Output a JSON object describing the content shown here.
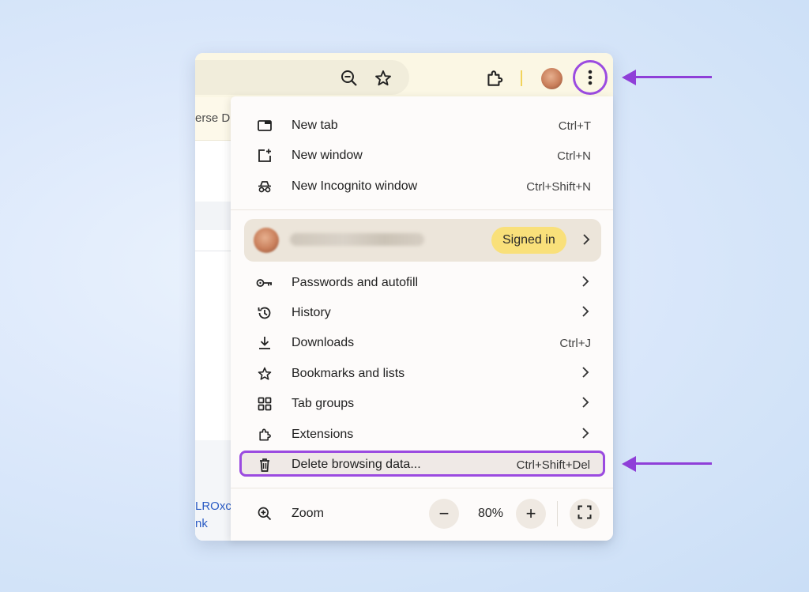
{
  "bookmark_bar": {
    "partial_text": "erse Di"
  },
  "page_links": {
    "line1": "LROxc",
    "line2": "nk"
  },
  "menu": {
    "items_top": [
      {
        "label": "New tab",
        "shortcut": "Ctrl+T",
        "icon": "new-tab-icon"
      },
      {
        "label": "New window",
        "shortcut": "Ctrl+N",
        "icon": "new-window-icon"
      },
      {
        "label": "New Incognito window",
        "shortcut": "Ctrl+Shift+N",
        "icon": "incognito-icon"
      }
    ],
    "profile": {
      "status": "Signed in"
    },
    "items_main": [
      {
        "label": "Passwords and autofill",
        "icon": "key-icon"
      },
      {
        "label": "History",
        "icon": "history-icon"
      },
      {
        "label": "Downloads",
        "shortcut": "Ctrl+J",
        "icon": "download-icon"
      },
      {
        "label": "Bookmarks and lists",
        "icon": "star-icon"
      },
      {
        "label": "Tab groups",
        "icon": "tab-groups-icon"
      },
      {
        "label": "Extensions",
        "icon": "puzzle-icon"
      }
    ],
    "delete": {
      "label": "Delete browsing data...",
      "shortcut": "Ctrl+Shift+Del",
      "icon": "trash-icon"
    },
    "zoom": {
      "label": "Zoom",
      "value": "80%",
      "minus": "−",
      "plus": "+"
    }
  },
  "colors": {
    "highlight": "#9b4be0",
    "arrow": "#8f3fd8",
    "signed_in_badge": "#f9e07a"
  }
}
